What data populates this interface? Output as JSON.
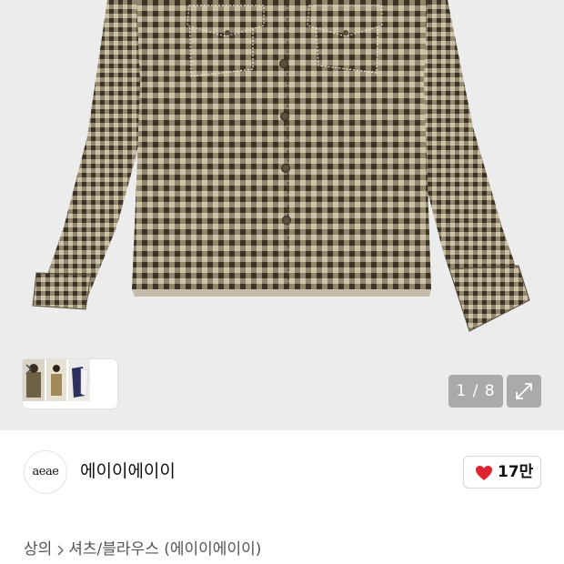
{
  "gallery": {
    "counter": "1 / 8",
    "colors": {
      "check_dark": "#3a3326",
      "check_light": "#c9bfa5",
      "check_mid": "#7d7258",
      "background": "#ececec"
    }
  },
  "thumbnails": {
    "arrow_icon": "chevron-right-icon"
  },
  "expand": {
    "icon": "expand-arrows-icon"
  },
  "brand": {
    "logo_text": "aeae",
    "name": "에이이에이이"
  },
  "like": {
    "icon": "heart-icon",
    "count": "17만",
    "color": "#e0242f"
  },
  "breadcrumb": {
    "level1": "상의",
    "level2": "셔츠/블라우스 (에이이에이이)"
  }
}
